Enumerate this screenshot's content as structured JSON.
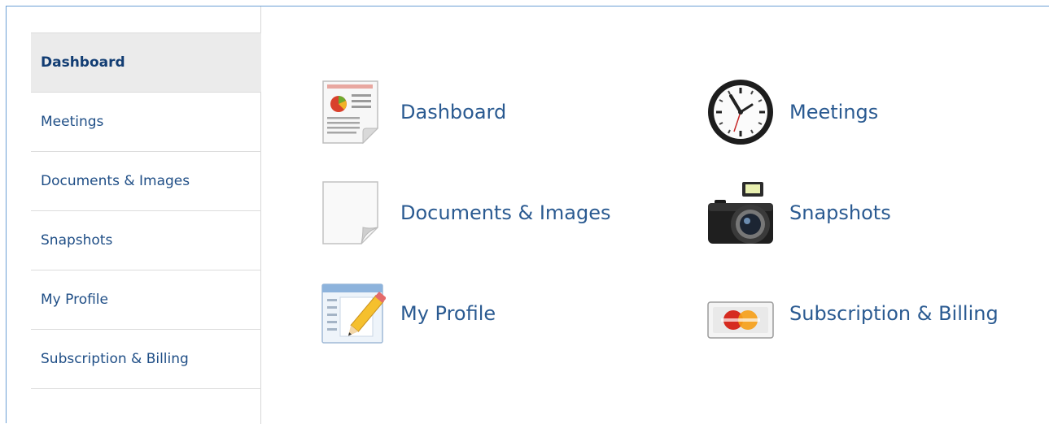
{
  "sidebar": {
    "items": [
      {
        "label": "Dashboard",
        "active": true
      },
      {
        "label": "Meetings"
      },
      {
        "label": "Documents & Images"
      },
      {
        "label": "Snapshots"
      },
      {
        "label": "My Profile"
      },
      {
        "label": "Subscription & Billing"
      }
    ]
  },
  "tiles": {
    "dashboard": {
      "label": "Dashboard",
      "icon": "report-document-icon"
    },
    "meetings": {
      "label": "Meetings",
      "icon": "clock-icon"
    },
    "documents": {
      "label": "Documents & Images",
      "icon": "blank-page-icon"
    },
    "snapshots": {
      "label": "Snapshots",
      "icon": "camera-icon"
    },
    "profile": {
      "label": "My Profile",
      "icon": "edit-form-icon"
    },
    "billing": {
      "label": "Subscription & Billing",
      "icon": "credit-card-icon"
    }
  },
  "colors": {
    "frame_border": "#6a9fd4",
    "link_text": "#2a5a91",
    "active_bg": "#ebebeb"
  }
}
